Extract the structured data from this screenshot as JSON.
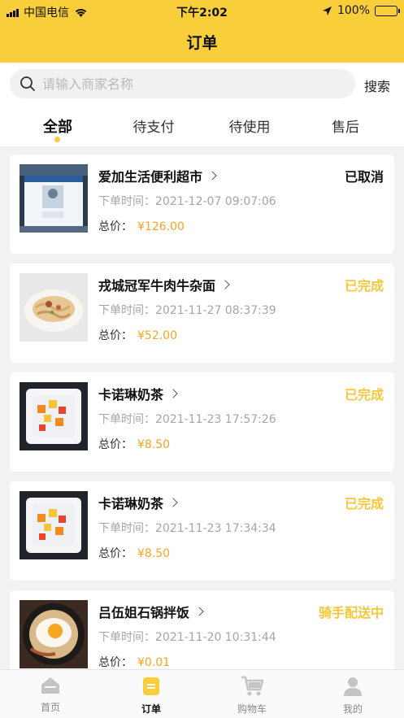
{
  "status_bar": {
    "carrier": "中国电信",
    "time": "下午2:02",
    "battery": "100%"
  },
  "header": {
    "title": "订单"
  },
  "search": {
    "placeholder": "请输入商家名称",
    "button_label": "搜索"
  },
  "tabs": [
    {
      "label": "全部",
      "active": true
    },
    {
      "label": "待支付",
      "active": false
    },
    {
      "label": "待使用",
      "active": false
    },
    {
      "label": "售后",
      "active": false
    }
  ],
  "orders": [
    {
      "shop": "爱加生活便利超市",
      "status": "已取消",
      "status_color": "#111111",
      "time_label": "下单时间：",
      "time": "2021-12-07 09:07:06",
      "price_label": "总价：",
      "price": "¥126.00",
      "thumb": "bag-photo"
    },
    {
      "shop": "戎城冠军牛肉牛杂面",
      "status": "已完成",
      "status_color": "#f5c73a",
      "time_label": "下单时间：",
      "time": "2021-11-27 08:37:39",
      "price_label": "总价：",
      "price": "¥52.00",
      "thumb": "noodles-photo"
    },
    {
      "shop": "卡诺琳奶茶",
      "status": "已完成",
      "status_color": "#f5c73a",
      "time_label": "下单时间：",
      "time": "2021-11-23 17:57:26",
      "price_label": "总价：",
      "price": "¥8.50",
      "thumb": "dessert-photo"
    },
    {
      "shop": "卡诺琳奶茶",
      "status": "已完成",
      "status_color": "#f5c73a",
      "time_label": "下单时间：",
      "time": "2021-11-23 17:34:34",
      "price_label": "总价：",
      "price": "¥8.50",
      "thumb": "dessert-photo"
    },
    {
      "shop": "吕伍姐石锅拌饭",
      "status": "骑手配送中",
      "status_color": "#f5c73a",
      "time_label": "下单时间：",
      "time": "2021-11-20 10:31:44",
      "price_label": "总价：",
      "price": "¥0.01",
      "thumb": "egg-rice-photo"
    }
  ],
  "tabbar": [
    {
      "label": "首页",
      "icon": "home-icon",
      "active": false
    },
    {
      "label": "订单",
      "icon": "order-icon",
      "active": true
    },
    {
      "label": "购物车",
      "icon": "cart-icon",
      "active": false
    },
    {
      "label": "我的",
      "icon": "profile-icon",
      "active": false
    }
  ],
  "colors": {
    "brand": "#f8cf3a",
    "price": "#f5a623",
    "muted": "#a5a5a5"
  }
}
